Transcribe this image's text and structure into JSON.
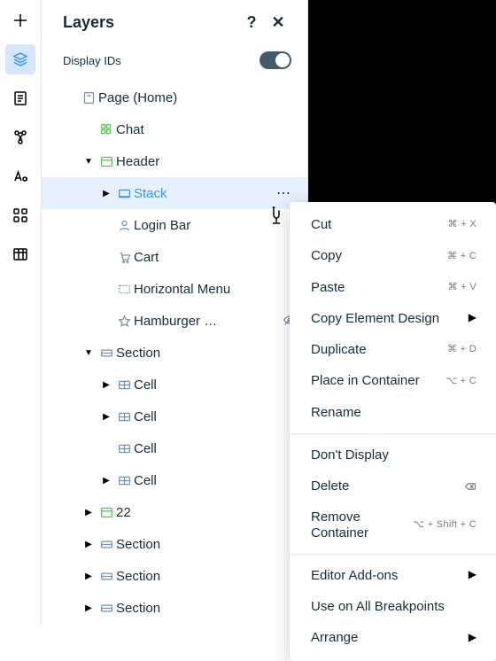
{
  "panel": {
    "title": "Layers",
    "display_ids_label": "Display IDs",
    "display_ids_on": true
  },
  "rail": [
    {
      "name": "add-icon"
    },
    {
      "name": "layers-icon",
      "active": true
    },
    {
      "name": "pages-icon"
    },
    {
      "name": "collections-icon"
    },
    {
      "name": "typography-icon"
    },
    {
      "name": "apps-icon"
    },
    {
      "name": "cms-icon"
    }
  ],
  "tree": {
    "page": {
      "label": "Page (Home)",
      "icon": "page",
      "disclosure": null,
      "indent": 0,
      "iconColor": "muted"
    },
    "items": [
      {
        "label": "Chat",
        "icon": "grid4",
        "disclosure": null,
        "indent": 1,
        "iconColor": "green"
      },
      {
        "label": "Header",
        "icon": "container",
        "disclosure": "down",
        "indent": 1,
        "iconColor": "green"
      },
      {
        "label": "Stack",
        "icon": "stack",
        "disclosure": "right",
        "indent": 2,
        "selected": true,
        "moreDots": true
      },
      {
        "label": "Login Bar",
        "icon": "avatar",
        "disclosure": null,
        "indent": 2
      },
      {
        "label": "Cart",
        "icon": "cart",
        "disclosure": null,
        "indent": 2
      },
      {
        "label": "Horizontal Menu",
        "icon": "dashed",
        "disclosure": null,
        "indent": 2
      },
      {
        "label": "Hamburger …",
        "icon": "star",
        "disclosure": null,
        "indent": 2,
        "hidden": true
      },
      {
        "label": "Section",
        "icon": "section",
        "disclosure": "down",
        "indent": 1,
        "iconColor": "muted"
      },
      {
        "label": "Cell",
        "icon": "cell",
        "disclosure": "right",
        "indent": 2
      },
      {
        "label": "Cell",
        "icon": "cell",
        "disclosure": "right",
        "indent": 2
      },
      {
        "label": "Cell",
        "icon": "cell",
        "disclosure": null,
        "indent": 2
      },
      {
        "label": "Cell",
        "icon": "cell",
        "disclosure": "right",
        "indent": 2
      },
      {
        "label": "22",
        "icon": "container",
        "disclosure": "right",
        "indent": 1,
        "iconColor": "green"
      },
      {
        "label": "Section",
        "icon": "section",
        "disclosure": "right",
        "indent": 1,
        "iconColor": "muted"
      },
      {
        "label": "Section",
        "icon": "section",
        "disclosure": "right",
        "indent": 1,
        "iconColor": "muted"
      },
      {
        "label": "Section",
        "icon": "section",
        "disclosure": "right",
        "indent": 1,
        "iconColor": "muted"
      }
    ]
  },
  "context_menu": [
    {
      "type": "item",
      "label": "Cut",
      "shortcut": "⌘ + X"
    },
    {
      "type": "item",
      "label": "Copy",
      "shortcut": "⌘ + C"
    },
    {
      "type": "item",
      "label": "Paste",
      "shortcut": "⌘ + V"
    },
    {
      "type": "item",
      "label": "Copy Element Design",
      "chev": true
    },
    {
      "type": "item",
      "label": "Duplicate",
      "shortcut": "⌘ + D"
    },
    {
      "type": "item",
      "label": "Place in Container",
      "shortcut": "⌥ + C"
    },
    {
      "type": "item",
      "label": "Rename"
    },
    {
      "type": "sep"
    },
    {
      "type": "item",
      "label": "Don't Display"
    },
    {
      "type": "item",
      "label": "Delete",
      "shortcut_icon": "backspace"
    },
    {
      "type": "item",
      "label": "Remove Container",
      "shortcut": "⌥ + Shift + C"
    },
    {
      "type": "sep"
    },
    {
      "type": "item",
      "label": "Editor Add-ons",
      "chev": true
    },
    {
      "type": "item",
      "label": "Use on All Breakpoints"
    },
    {
      "type": "item",
      "label": "Arrange",
      "chev": true
    }
  ]
}
